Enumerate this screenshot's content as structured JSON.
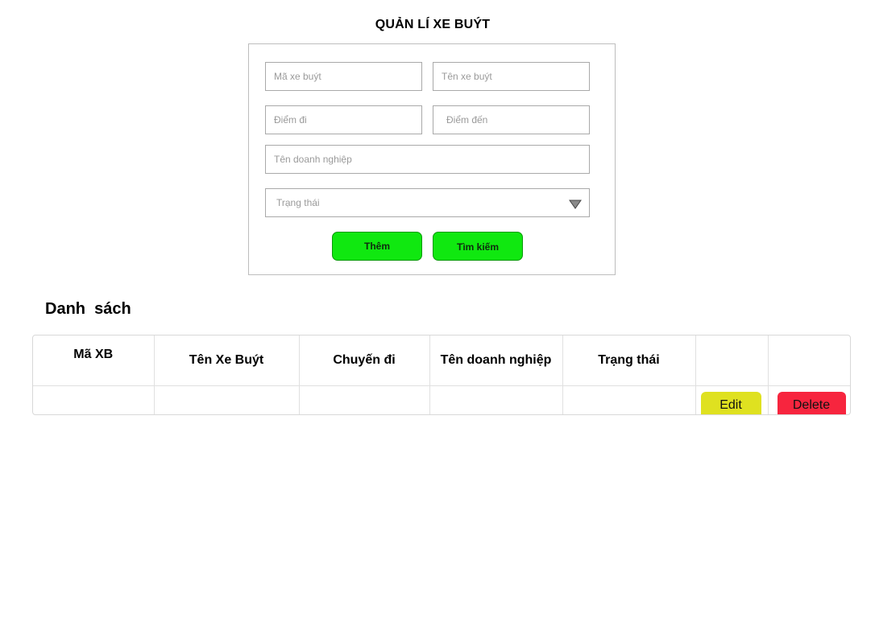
{
  "page": {
    "title": "QUẢN LÍ XE BUÝT"
  },
  "form": {
    "bus_id": {
      "placeholder": "Mã xe buýt",
      "value": ""
    },
    "bus_name": {
      "placeholder": "Tên xe buýt",
      "value": ""
    },
    "origin": {
      "placeholder": "Điểm đi",
      "value": ""
    },
    "destination": {
      "placeholder": "Điểm đến",
      "value": ""
    },
    "company": {
      "placeholder": "Tên doanh nghiệp",
      "value": ""
    },
    "status": {
      "placeholder": "Trạng thái",
      "icon": "triangle-down-icon"
    },
    "add_label": "Thêm",
    "search_label": "Tìm kiếm"
  },
  "list": {
    "title": "Danh  sách",
    "columns": [
      "Mã XB",
      "Tên Xe Buýt",
      "Chuyến đi",
      "Tên doanh nghiệp",
      "Trạng thái",
      "",
      ""
    ],
    "rows": [
      {
        "bus_id": "",
        "bus_name": "",
        "route": "",
        "company": "",
        "status": ""
      }
    ],
    "edit_label": "Edit",
    "delete_label": "Delete"
  },
  "colors": {
    "primary_button": "#10e810",
    "edit_button": "#dfe120",
    "delete_button": "#f7253e"
  }
}
